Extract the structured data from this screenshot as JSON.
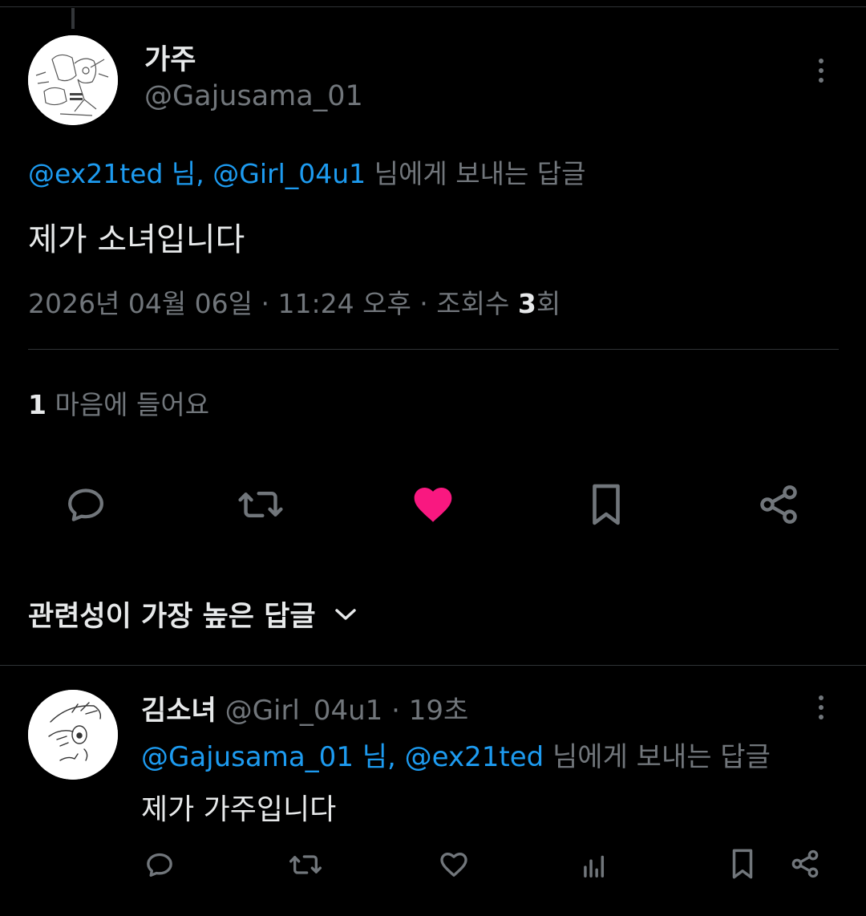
{
  "tweet": {
    "author": {
      "display_name": "가주",
      "handle": "@Gajusama_01",
      "avatar": "sketch-avatar"
    },
    "replying_to": {
      "mention1": "@ex21ted 님,",
      "mention2": "@Girl_04u1",
      "suffix": " 님에게 보내는 답글"
    },
    "text": "제가 소녀입니다",
    "meta": {
      "date_time": "2026년 04월 06일 · 11:24 오후 · 조회수 ",
      "views": "3",
      "views_suffix": "회"
    },
    "likes": {
      "count": "1",
      "label": " 마음에 들어요"
    },
    "actions": {
      "reply_icon": "reply-icon",
      "retweet_icon": "retweet-icon",
      "like_icon": "heart-filled-icon",
      "bookmark_icon": "bookmark-icon",
      "share_icon": "share-icon",
      "like_color": "#f91880"
    }
  },
  "sort": {
    "label": "관련성이 가장 높은 답글"
  },
  "reply": {
    "author": {
      "display_name": "김소녀",
      "handle_time": " @Girl_04u1 · 19초"
    },
    "replying_to": {
      "mention1": "@Gajusama_01 님,",
      "mention2": "@ex21ted",
      "suffix": " 님에게 보내는 답글"
    },
    "text": "제가 가주입니다"
  },
  "colors": {
    "background": "#000000",
    "text_primary": "#e7e9ea",
    "text_secondary": "#71767b",
    "link": "#1d9bf0",
    "divider": "#2f3336"
  }
}
